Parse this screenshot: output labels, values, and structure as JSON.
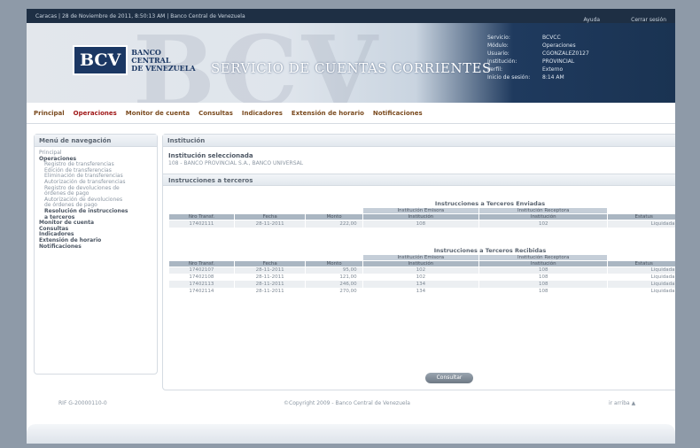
{
  "topbar": {
    "left": "Caracas | 28 de Noviembre de 2011, 8:50:13 AM | Banco Central de Venezuela",
    "help": "Ayuda",
    "logout": "Cerrar sesión"
  },
  "header": {
    "watermark": "BCV",
    "logo_box": "BCV",
    "logo_line1": "BANCO",
    "logo_line2": "CENTRAL",
    "logo_line3": "DE VENEZUELA",
    "title": "SERVICIO DE CUENTAS CORRIENTES",
    "info": [
      {
        "k": "Servicio:",
        "v": "BCVCC"
      },
      {
        "k": "Módulo:",
        "v": "Operaciones"
      },
      {
        "k": "Usuario:",
        "v": "CGONZALEZ0127"
      },
      {
        "k": "Institución:",
        "v": "PROVINCIAL"
      },
      {
        "k": "Perfil:",
        "v": "Externo"
      },
      {
        "k": "Inicio de sesión:",
        "v": "8:14 AM"
      }
    ]
  },
  "nav": [
    "Principal",
    "Operaciones",
    "Monitor de cuenta",
    "Consultas",
    "Indicadores",
    "Extensión de horario",
    "Notificaciones"
  ],
  "sidebar": {
    "title": "Menú de navegación",
    "items": [
      "Principal",
      "Operaciones",
      "Registro de transferencias",
      "Edición de transferencias",
      "Eliminación de transferencias",
      "Autorización de transferencias",
      "Registro de devoluciones de",
      "órdenes de pago",
      "Autorización de devoluciones",
      "de órdenes de pago",
      "Resolución de instrucciones",
      "a terceros",
      "Monitor de cuenta",
      "Consultas",
      "Indicadores",
      "Extensión de horario",
      "Notificaciones"
    ]
  },
  "content": {
    "title": "Institución",
    "selected_label": "Institución seleccionada",
    "selected_value": "108 - BANCO PROVINCIAL S.A., BANCO UNIVERSAL",
    "section": "Instrucciones a terceros",
    "sent": {
      "title": "Instrucciones a Terceros Enviadas",
      "group1": "Institución Emisora",
      "group2": "Institución Receptora",
      "headers": [
        "Nro Transf.",
        "Fecha",
        "Monto",
        "Institución",
        "Institución",
        "Estatus"
      ],
      "rows": [
        [
          "17402111",
          "28-11-2011",
          "222,00",
          "108",
          "102",
          "Liquidada"
        ]
      ]
    },
    "received": {
      "title": "Instrucciones a Terceros Recibidas",
      "group1": "Institución Emisora",
      "group2": "Institución Receptora",
      "headers": [
        "Nro Transf.",
        "Fecha",
        "Monto",
        "Institución",
        "Institución",
        "Estatus"
      ],
      "rows": [
        [
          "17402107",
          "28-11-2011",
          "95,00",
          "102",
          "108",
          "Liquidada"
        ],
        [
          "17402108",
          "28-11-2011",
          "121,00",
          "102",
          "108",
          "Liquidada"
        ],
        [
          "17402113",
          "28-11-2011",
          "246,00",
          "134",
          "108",
          "Liquidada"
        ],
        [
          "17402114",
          "28-11-2011",
          "270,00",
          "134",
          "108",
          "Liquidada"
        ]
      ]
    },
    "button": "Consultar"
  },
  "footer": {
    "rif": "RIF G-20000110-0",
    "copyright": "©Copyright 2009 - Banco Central de Venezuela",
    "top": "ir arriba"
  }
}
